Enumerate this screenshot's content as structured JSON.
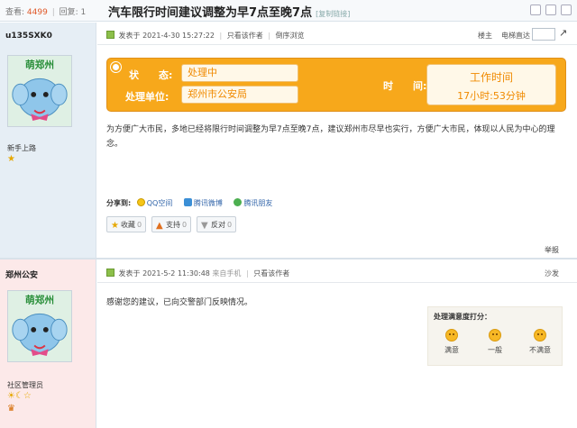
{
  "header": {
    "views_label": "查看:",
    "views_value": "4499",
    "replies_label": "回复:",
    "replies_value": "1",
    "thread_title": "汽车限行时间建议调整为早7点至晚7点",
    "copy_link": "[复制链接]",
    "tools": [
      "print-icon",
      "prev-icon",
      "next-icon"
    ]
  },
  "post1": {
    "username": "u135SXK0",
    "avatar_caption": "萌郑州",
    "rank": "新手上路",
    "posted_label": "发表于 2021-4-30 15:27:22",
    "only_author": "只看该作者",
    "reverse_order": "倒序浏览",
    "floor_label": "楼主",
    "jump_label": "电梯直达",
    "status_label": "状　　态:",
    "status_value": "处理中",
    "unit_label": "处理单位:",
    "unit_value": "郑州市公安局",
    "time_label": "时　　间:",
    "time_title": "工作时间",
    "time_value": "17小时:53分钟",
    "body": "为方便广大市民，多地已经将限行时间调整为早7点至晚7点，建议郑州市尽早也实行，方便广大市民，体现以人民为中心的理念。",
    "share_label": "分享到:",
    "share_items": [
      "QQ空间",
      "腾讯微博",
      "腾讯朋友"
    ],
    "vote_buttons": [
      {
        "label": "收藏",
        "count": "0"
      },
      {
        "label": "支持",
        "count": "0"
      },
      {
        "label": "反对",
        "count": "0"
      }
    ],
    "report": "举报"
  },
  "post2": {
    "username": "郑州公安",
    "avatar_caption": "萌郑州",
    "rank": "社区管理员",
    "posted_label": "发表于 2021-5-2 11:30:48",
    "source": "来自手机",
    "only_author": "只看该作者",
    "floor_label": "沙发",
    "body": "感谢您的建议，已向交警部门反映情况。",
    "rating_title": "处理满意度打分：",
    "rating_options": [
      "满意",
      "一般",
      "不满意"
    ]
  },
  "colors": {
    "status_orange": "#f7a81b",
    "status_text": "#f08a00",
    "sidebar_blue": "#e6eef5",
    "sidebar_pink": "#fce9e9"
  }
}
